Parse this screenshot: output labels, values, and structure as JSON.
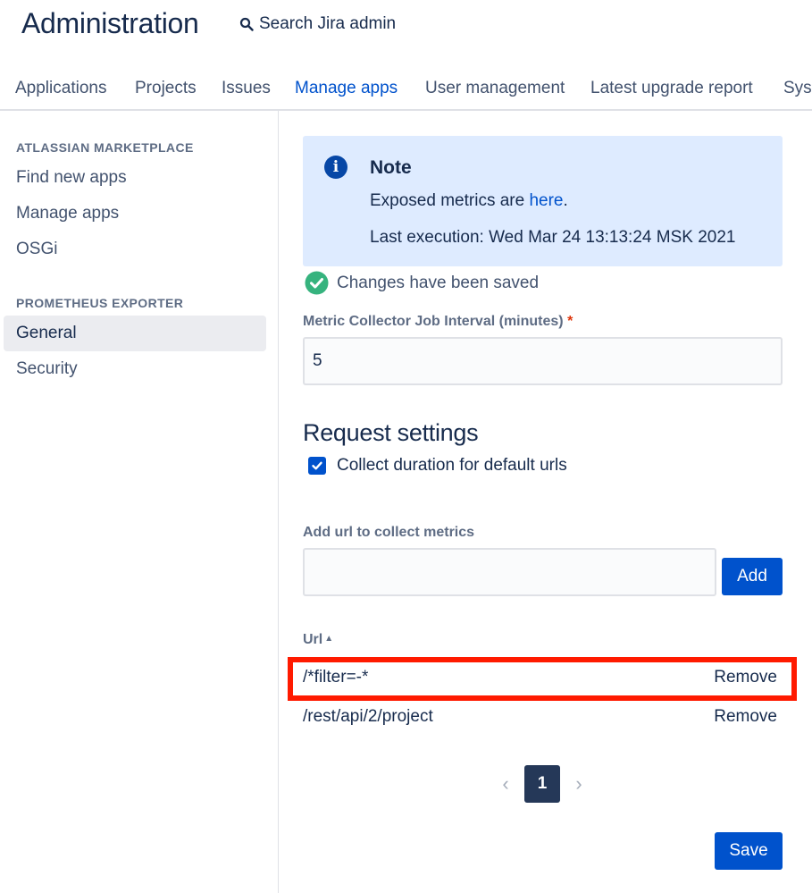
{
  "header": {
    "title": "Administration",
    "search_label": "Search Jira admin"
  },
  "tabs": [
    {
      "label": "Applications"
    },
    {
      "label": "Projects"
    },
    {
      "label": "Issues"
    },
    {
      "label": "Manage apps",
      "active": true
    },
    {
      "label": "User management"
    },
    {
      "label": "Latest upgrade report"
    },
    {
      "label": "Sys"
    }
  ],
  "sidebar": {
    "section1": {
      "heading": "ATLASSIAN MARKETPLACE",
      "items": [
        {
          "label": "Find new apps"
        },
        {
          "label": "Manage apps"
        },
        {
          "label": "OSGi"
        }
      ]
    },
    "section2": {
      "heading": "PROMETHEUS EXPORTER",
      "items": [
        {
          "label": "General",
          "selected": true
        },
        {
          "label": "Security"
        }
      ]
    }
  },
  "note": {
    "title": "Note",
    "line1_prefix": "Exposed metrics are",
    "line1_link": "here",
    "line1_suffix": ".",
    "line2": "Last execution: Wed Mar 24 13:13:24 MSK 2021"
  },
  "saved_message": "Changes have been saved",
  "interval": {
    "label": "Metric Collector Job Interval (minutes)",
    "required_mark": "*",
    "value": "5"
  },
  "request_settings": {
    "title": "Request settings",
    "checkbox_label": "Collect duration for default urls",
    "checked": true
  },
  "add_url": {
    "label": "Add url to collect metrics",
    "value": "",
    "button_label": "Add"
  },
  "url_table": {
    "header": "Url",
    "rows": [
      {
        "url": "/*filter=-*",
        "action": "Remove"
      },
      {
        "url": "/rest/api/2/project",
        "action": "Remove"
      }
    ]
  },
  "pagination": {
    "prev": "‹",
    "current": "1",
    "next": "›"
  },
  "save_button": "Save",
  "colors": {
    "primary": "#0052cc",
    "highlight": "#ff1a00",
    "success": "#36b37e"
  }
}
